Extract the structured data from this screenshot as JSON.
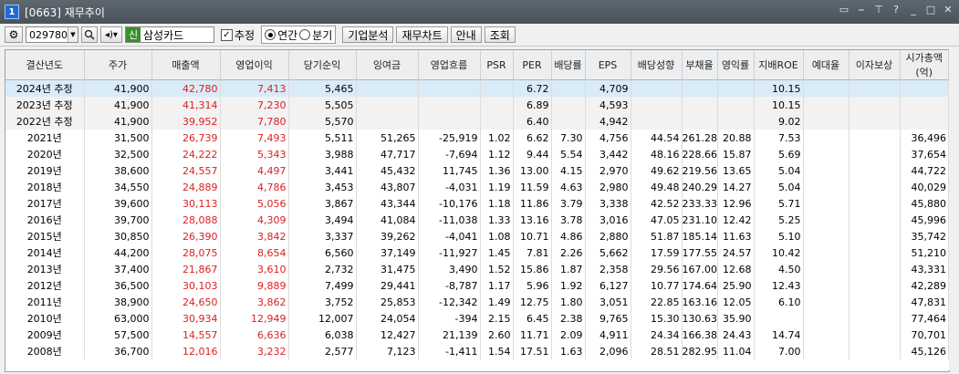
{
  "window": {
    "number": "1",
    "title": "[0663] 재무추이",
    "controls": [
      "layout-icon",
      "minimize-panel-icon",
      "pin-icon",
      "help-icon",
      "minimize-icon",
      "maximize-icon",
      "close-icon"
    ]
  },
  "toolbar": {
    "settings_icon": "gear-icon",
    "code": "029780",
    "search_icon": "search-icon",
    "sound_icon": "speaker-icon",
    "market_tag": "신",
    "stock_name": "삼성카드",
    "estimate_label": "추정",
    "estimate_checked": true,
    "annual_label": "연간",
    "quarter_label": "분기",
    "period_selected": "annual",
    "btn_company": "기업분석",
    "btn_chart": "재무차트",
    "btn_guide": "안내",
    "btn_query": "조회"
  },
  "table": {
    "headers": [
      "결산년도",
      "주가",
      "매출액",
      "영업이익",
      "당기순익",
      "잉여금",
      "영업흐름",
      "PSR",
      "PER",
      "배당률",
      "EPS",
      "배당성향",
      "부채율",
      "영익률",
      "지배ROE",
      "예대율",
      "이자보상",
      "시가총액(억)"
    ],
    "rows": [
      {
        "year": "2024년 추정",
        "cells": [
          "41,900",
          "42,780",
          "7,413",
          "5,465",
          "",
          "",
          "",
          "6.72",
          "",
          "4,709",
          "",
          "",
          "",
          "10.15",
          "",
          "",
          ""
        ],
        "type": "sel"
      },
      {
        "year": "2023년 추정",
        "cells": [
          "41,900",
          "41,314",
          "7,230",
          "5,505",
          "",
          "",
          "",
          "6.89",
          "",
          "4,593",
          "",
          "",
          "",
          "10.15",
          "",
          "",
          ""
        ],
        "type": "est"
      },
      {
        "year": "2022년 추정",
        "cells": [
          "41,900",
          "39,952",
          "7,780",
          "5,570",
          "",
          "",
          "",
          "6.40",
          "",
          "4,942",
          "",
          "",
          "",
          "9.02",
          "",
          "",
          ""
        ],
        "type": "est"
      },
      {
        "year": "2021년",
        "cells": [
          "31,500",
          "26,739",
          "7,493",
          "5,511",
          "51,265",
          "-25,919",
          "1.02",
          "6.62",
          "7.30",
          "4,756",
          "44.54",
          "261.28",
          "20.88",
          "7.53",
          "",
          "",
          "36,496"
        ],
        "type": ""
      },
      {
        "year": "2020년",
        "cells": [
          "32,500",
          "24,222",
          "5,343",
          "3,988",
          "47,717",
          "-7,694",
          "1.12",
          "9.44",
          "5.54",
          "3,442",
          "48.16",
          "228.66",
          "15.87",
          "5.69",
          "",
          "",
          "37,654"
        ],
        "type": ""
      },
      {
        "year": "2019년",
        "cells": [
          "38,600",
          "24,557",
          "4,497",
          "3,441",
          "45,432",
          "11,745",
          "1.36",
          "13.00",
          "4.15",
          "2,970",
          "49.62",
          "219.56",
          "13.65",
          "5.04",
          "",
          "",
          "44,722"
        ],
        "type": ""
      },
      {
        "year": "2018년",
        "cells": [
          "34,550",
          "24,889",
          "4,786",
          "3,453",
          "43,807",
          "-4,031",
          "1.19",
          "11.59",
          "4.63",
          "2,980",
          "49.48",
          "240.29",
          "14.27",
          "5.04",
          "",
          "",
          "40,029"
        ],
        "type": ""
      },
      {
        "year": "2017년",
        "cells": [
          "39,600",
          "30,113",
          "5,056",
          "3,867",
          "43,344",
          "-10,176",
          "1.18",
          "11.86",
          "3.79",
          "3,338",
          "42.52",
          "233.33",
          "12.96",
          "5.71",
          "",
          "",
          "45,880"
        ],
        "type": ""
      },
      {
        "year": "2016년",
        "cells": [
          "39,700",
          "28,088",
          "4,309",
          "3,494",
          "41,084",
          "-11,038",
          "1.33",
          "13.16",
          "3.78",
          "3,016",
          "47.05",
          "231.10",
          "12.42",
          "5.25",
          "",
          "",
          "45,996"
        ],
        "type": ""
      },
      {
        "year": "2015년",
        "cells": [
          "30,850",
          "26,390",
          "3,842",
          "3,337",
          "39,262",
          "-4,041",
          "1.08",
          "10.71",
          "4.86",
          "2,880",
          "51.87",
          "185.14",
          "11.63",
          "5.10",
          "",
          "",
          "35,742"
        ],
        "type": ""
      },
      {
        "year": "2014년",
        "cells": [
          "44,200",
          "28,075",
          "8,654",
          "6,560",
          "37,149",
          "-11,927",
          "1.45",
          "7.81",
          "2.26",
          "5,662",
          "17.59",
          "177.55",
          "24.57",
          "10.42",
          "",
          "",
          "51,210"
        ],
        "type": ""
      },
      {
        "year": "2013년",
        "cells": [
          "37,400",
          "21,867",
          "3,610",
          "2,732",
          "31,475",
          "3,490",
          "1.52",
          "15.86",
          "1.87",
          "2,358",
          "29.56",
          "167.00",
          "12.68",
          "4.50",
          "",
          "",
          "43,331"
        ],
        "type": ""
      },
      {
        "year": "2012년",
        "cells": [
          "36,500",
          "30,103",
          "9,889",
          "7,499",
          "29,441",
          "-8,787",
          "1.17",
          "5.96",
          "1.92",
          "6,127",
          "10.77",
          "174.64",
          "25.90",
          "12.43",
          "",
          "",
          "42,289"
        ],
        "type": ""
      },
      {
        "year": "2011년",
        "cells": [
          "38,900",
          "24,650",
          "3,862",
          "3,752",
          "25,853",
          "-12,342",
          "1.49",
          "12.75",
          "1.80",
          "3,051",
          "22.85",
          "163.16",
          "12.05",
          "6.10",
          "",
          "",
          "47,831"
        ],
        "type": ""
      },
      {
        "year": "2010년",
        "cells": [
          "63,000",
          "30,934",
          "12,949",
          "12,007",
          "24,054",
          "-394",
          "2.15",
          "6.45",
          "2.38",
          "9,765",
          "15.30",
          "130.63",
          "35.90",
          "",
          "",
          "",
          "77,464"
        ],
        "type": ""
      },
      {
        "year": "2009년",
        "cells": [
          "57,500",
          "14,557",
          "6,636",
          "6,038",
          "12,427",
          "21,139",
          "2.60",
          "11.71",
          "2.09",
          "4,911",
          "24.34",
          "166.38",
          "24.43",
          "14.74",
          "",
          "",
          "70,701"
        ],
        "type": ""
      },
      {
        "year": "2008년",
        "cells": [
          "36,700",
          "12,016",
          "3,232",
          "2,577",
          "7,123",
          "-1,411",
          "1.54",
          "17.51",
          "1.63",
          "2,096",
          "28.51",
          "282.95",
          "11.04",
          "7.00",
          "",
          "",
          "45,126"
        ],
        "type": ""
      }
    ],
    "red_columns": [
      2,
      3
    ],
    "red_color": "#dd1e1e"
  }
}
